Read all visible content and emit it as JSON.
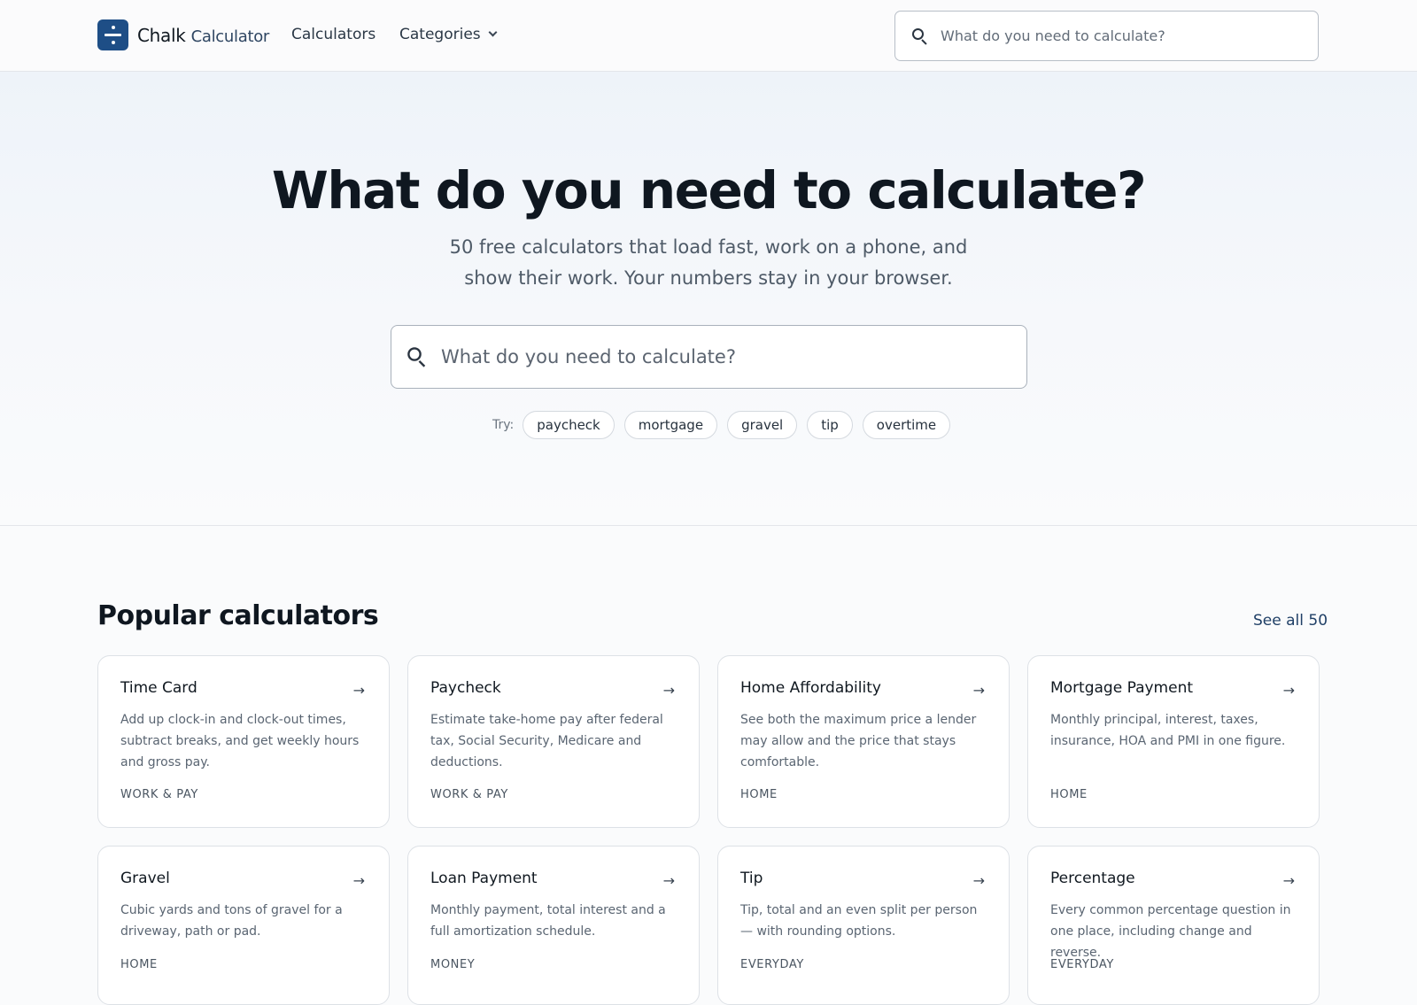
{
  "header": {
    "logo_bold": "Chalk",
    "logo_light": "Calculator",
    "nav_calculators": "Calculators",
    "nav_categories": "Categories",
    "search_placeholder": "What do you need to calculate?"
  },
  "hero": {
    "title": "What do you need to calculate?",
    "subtitle": "50 free calculators that load fast, work on a phone, and show their work. Your numbers stay in your browser.",
    "search_placeholder": "What do you need to calculate?",
    "try_label": "Try:",
    "chips": [
      "paycheck",
      "mortgage",
      "gravel",
      "tip",
      "overtime"
    ]
  },
  "popular": {
    "title": "Popular calculators",
    "see_all": "See all 50",
    "cards": [
      {
        "title": "Time Card",
        "desc": "Add up clock-in and clock-out times, subtract breaks, and get weekly hours and gross pay.",
        "category": "WORK & PAY"
      },
      {
        "title": "Paycheck",
        "desc": "Estimate take-home pay after federal tax, Social Security, Medicare and deductions.",
        "category": "WORK & PAY"
      },
      {
        "title": "Home Affordability",
        "desc": "See both the maximum price a lender may allow and the price that stays comfortable.",
        "category": "HOME"
      },
      {
        "title": "Mortgage Payment",
        "desc": "Monthly principal, interest, taxes, insurance, HOA and PMI in one figure.",
        "category": "HOME"
      },
      {
        "title": "Gravel",
        "desc": "Cubic yards and tons of gravel for a driveway, path or pad.",
        "category": "HOME"
      },
      {
        "title": "Loan Payment",
        "desc": "Monthly payment, total interest and a full amortization schedule.",
        "category": "MONEY"
      },
      {
        "title": "Tip",
        "desc": "Tip, total and an even split per person — with rounding options.",
        "category": "EVERYDAY"
      },
      {
        "title": "Percentage",
        "desc": "Every common percentage question in one place, including change and reverse.",
        "category": "EVERYDAY"
      }
    ]
  }
}
